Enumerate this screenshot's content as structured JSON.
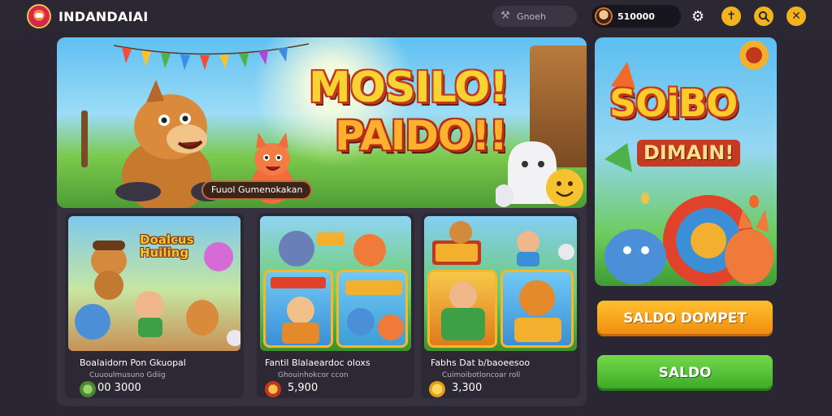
{
  "header": {
    "app_title": "INDANDAIAI",
    "search_label": "Gnoeh",
    "balance": "510000"
  },
  "hero": {
    "title_line1": "MOSILO!",
    "title_line2": "PAIDO!!",
    "caption": "Fuuol Gumenokakan"
  },
  "cards": [
    {
      "art_label": "Doalcus\nHuiling",
      "title": "Boalaidorn Pon Gkuopal",
      "subtitle": "Cuuoulmusuno Gdiig",
      "stat": "00 3000"
    },
    {
      "art_label": "",
      "title": "Fantil Blalaeardoc oloxs",
      "subtitle": "Ghouinhokcor ccon",
      "stat": "5,900"
    },
    {
      "art_label": "",
      "title": "Fabhs Dat b/baoeesoo",
      "subtitle": "Cuimoibotloncoar roll",
      "stat": "3,300"
    }
  ],
  "promo": {
    "title_line1": "SOiBO",
    "title_line2": "DIMAIN!"
  },
  "buttons": {
    "primary": "SALDO DOMPET",
    "secondary": "SALDO"
  },
  "colors": {
    "background": "#2a2633",
    "accent_yellow": "#f3b31c",
    "button_orange": "#f5a01a",
    "button_green": "#4fbf33"
  },
  "icons": {
    "settings": "gear-icon",
    "add": "cross-icon",
    "search": "search-icon",
    "close": "close-icon"
  }
}
